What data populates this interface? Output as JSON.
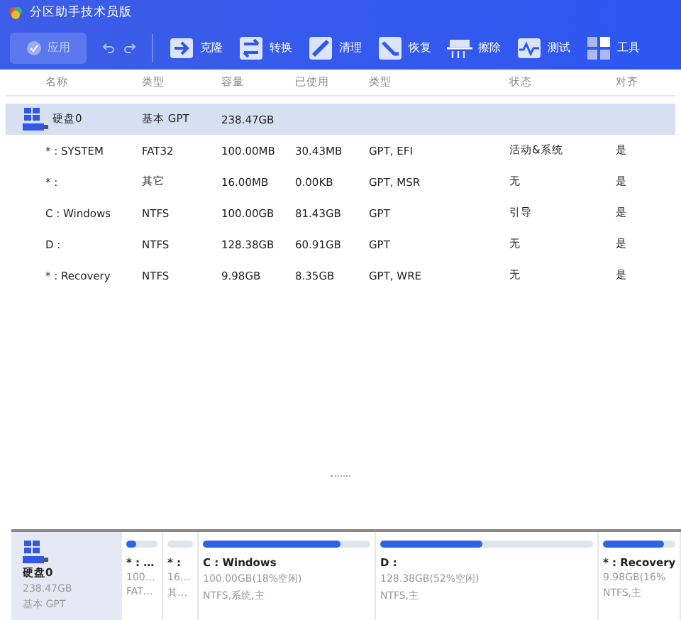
{
  "window": {
    "title": "分区助手技术员版"
  },
  "toolbar": {
    "apply": {
      "label": "应用",
      "disabled": true
    },
    "tools": [
      {
        "kind": "clone",
        "label": "克隆"
      },
      {
        "kind": "convert",
        "label": "转换"
      },
      {
        "kind": "clean",
        "label": "清理"
      },
      {
        "kind": "recover",
        "label": "恢复"
      },
      {
        "kind": "wipe",
        "label": "擦除"
      },
      {
        "kind": "test",
        "label": "测试"
      },
      {
        "kind": "tools",
        "label": "工具"
      }
    ]
  },
  "table": {
    "columns": [
      "名称",
      "类型",
      "容量",
      "已使用",
      "类型",
      "状态",
      "对齐"
    ],
    "rows": [
      {
        "kind": "disk",
        "selected": true,
        "cells": [
          "硬盘0",
          "基本 GPT",
          "238.47GB",
          "",
          "",
          "",
          ""
        ]
      },
      {
        "kind": "partition",
        "selected": false,
        "cells": [
          "* : SYSTEM",
          "FAT32",
          "100.00MB",
          "30.43MB",
          "GPT, EFI",
          "活动&系统",
          "是"
        ]
      },
      {
        "kind": "partition",
        "selected": false,
        "cells": [
          "* :",
          "其它",
          "16.00MB",
          "0.00KB",
          "GPT, MSR",
          "无",
          "是"
        ]
      },
      {
        "kind": "partition",
        "selected": false,
        "cells": [
          "C : Windows",
          "NTFS",
          "100.00GB",
          "81.43GB",
          "GPT",
          "引导",
          "是"
        ]
      },
      {
        "kind": "partition",
        "selected": false,
        "cells": [
          "D :",
          "NTFS",
          "128.38GB",
          "60.91GB",
          "GPT",
          "无",
          "是"
        ]
      },
      {
        "kind": "partition",
        "selected": false,
        "cells": [
          "* : Recovery",
          "NTFS",
          "9.98GB",
          "8.35GB",
          "GPT, WRE",
          "无",
          "是"
        ]
      }
    ]
  },
  "disk_map": {
    "disk": {
      "name": "硬盘0",
      "size": "238.47GB",
      "style": "基本 GPT"
    },
    "partitions": [
      {
        "name": "* : …",
        "detail": "100…",
        "fs": "FAT…",
        "level": 0.3
      },
      {
        "name": "* :",
        "detail": "16…",
        "fs": "其…",
        "level": 0
      },
      {
        "name": "C : Windows",
        "detail": "100.00GB(18%空闲)",
        "fs": "NTFS,系统,主",
        "level": 0.82
      },
      {
        "name": "D :",
        "detail": "128.38GB(52%空闲)",
        "fs": "NTFS,主",
        "level": 0.48
      },
      {
        "name": "* : Recovery",
        "detail": "9.98GB(16%",
        "fs": "NTFS,主",
        "level": 0.84
      }
    ]
  }
}
